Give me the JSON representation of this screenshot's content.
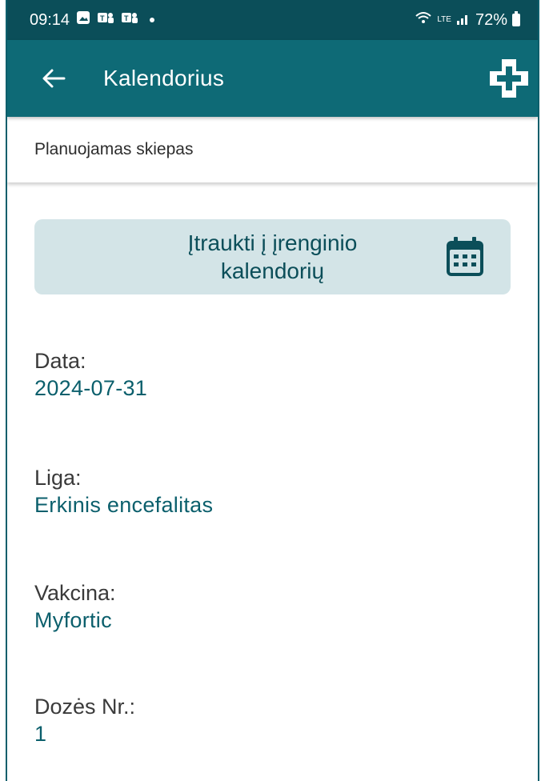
{
  "status_bar": {
    "time": "09:14",
    "battery": "72%",
    "network": "LTE"
  },
  "app_bar": {
    "title": "Kalendorius"
  },
  "subheader": {
    "text": "Planuojamas skiepas"
  },
  "add_to_calendar": {
    "label_line1": "Įtraukti į įrenginio",
    "label_line2": "kalendorių"
  },
  "fields": {
    "date": {
      "label": "Data:",
      "value": "2024-07-31"
    },
    "disease": {
      "label": "Liga:",
      "value": "Erkinis encefalitas"
    },
    "vaccine": {
      "label": "Vakcina:",
      "value": "Myfortic"
    },
    "dose": {
      "label": "Dozės Nr.:",
      "value": "1"
    }
  },
  "colors": {
    "status_bar": "#0b4e59",
    "app_bar": "#0e6a76",
    "accent_text": "#0b5f6c",
    "button_bg": "#d3e4e7"
  },
  "icons": {
    "back": "arrow-left-icon",
    "logo": "medical-cross-icon",
    "calendar": "calendar-icon"
  }
}
